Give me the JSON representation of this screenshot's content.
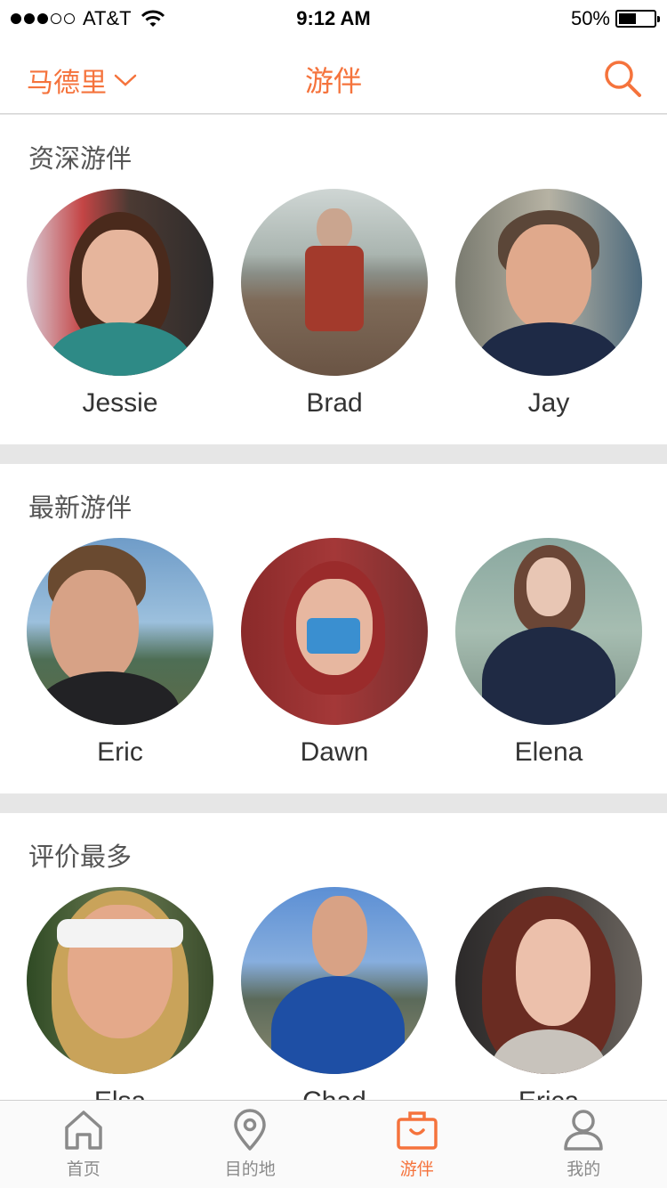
{
  "status_bar": {
    "carrier": "AT&T",
    "time": "9:12 AM",
    "battery": "50%",
    "battery_level": 0.5,
    "signal_bars": 3,
    "signal_total": 5
  },
  "nav": {
    "city": "马德里",
    "title": "游伴"
  },
  "sections": [
    {
      "title": "资深游伴",
      "guides": [
        {
          "name": "Jessie"
        },
        {
          "name": "Brad"
        },
        {
          "name": "Jay"
        }
      ]
    },
    {
      "title": "最新游伴",
      "guides": [
        {
          "name": "Eric"
        },
        {
          "name": "Dawn"
        },
        {
          "name": "Elena"
        }
      ]
    },
    {
      "title": "评价最多",
      "guides": [
        {
          "name": "Elsa"
        },
        {
          "name": "Chad"
        },
        {
          "name": "Erica"
        }
      ]
    }
  ],
  "tabs": [
    {
      "label": "首页",
      "icon": "home-icon",
      "active": false
    },
    {
      "label": "目的地",
      "icon": "location-pin-icon",
      "active": false
    },
    {
      "label": "游伴",
      "icon": "suitcase-icon",
      "active": true
    },
    {
      "label": "我的",
      "icon": "person-icon",
      "active": false
    }
  ],
  "colors": {
    "accent": "#f5733c",
    "text": "#333333",
    "muted": "#8a8a8a",
    "divider": "#e6e6e6"
  }
}
